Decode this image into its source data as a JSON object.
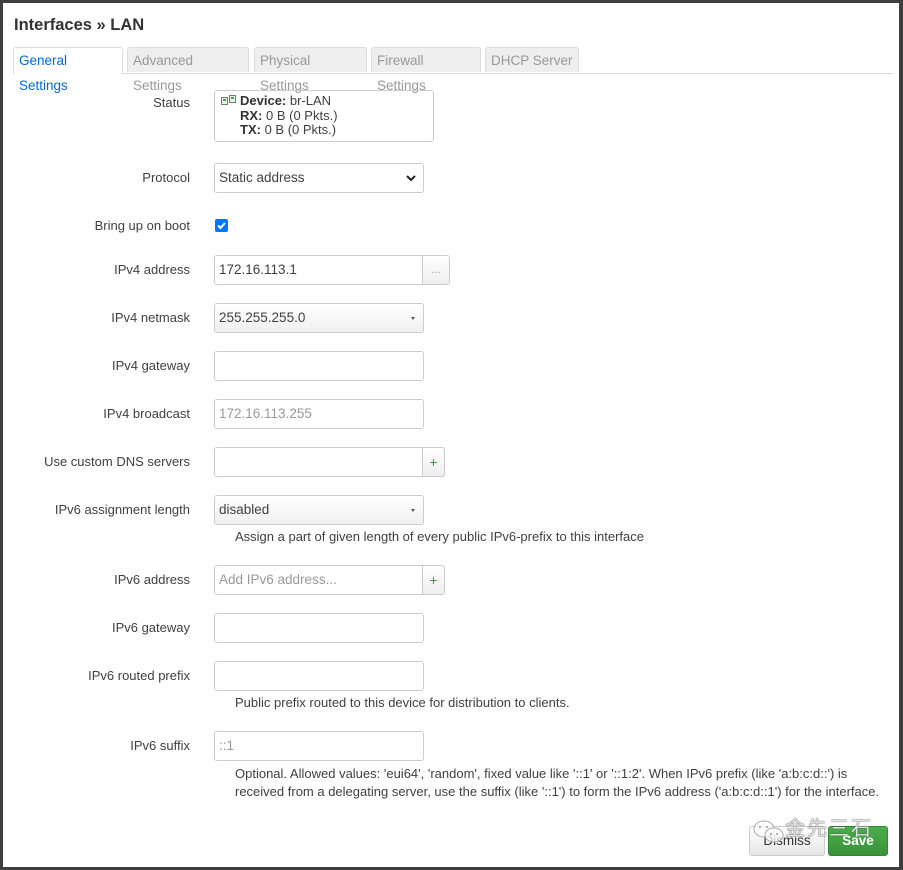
{
  "title": "Interfaces » LAN",
  "tabs": [
    {
      "label": "General Settings",
      "active": true
    },
    {
      "label": "Advanced Settings",
      "active": false
    },
    {
      "label": "Physical Settings",
      "active": false
    },
    {
      "label": "Firewall Settings",
      "active": false
    },
    {
      "label": "DHCP Server",
      "active": false
    }
  ],
  "form": {
    "status": {
      "label": "Status",
      "device_key": "Device:",
      "device_value": "br-LAN",
      "rx_key": "RX:",
      "rx_value": "0 B (0 Pkts.)",
      "tx_key": "TX:",
      "tx_value": "0 B (0 Pkts.)",
      "icon": "network-device-icon"
    },
    "protocol": {
      "label": "Protocol",
      "value": "Static address"
    },
    "bring_up_on_boot": {
      "label": "Bring up on boot",
      "checked": true
    },
    "ipv4_address": {
      "label": "IPv4 address",
      "value": "172.16.113.1",
      "addon": "..."
    },
    "ipv4_netmask": {
      "label": "IPv4 netmask",
      "value": "255.255.255.0"
    },
    "ipv4_gateway": {
      "label": "IPv4 gateway",
      "value": ""
    },
    "ipv4_broadcast": {
      "label": "IPv4 broadcast",
      "placeholder": "172.16.113.255"
    },
    "custom_dns": {
      "label": "Use custom DNS servers",
      "value": "",
      "addon": "+"
    },
    "ipv6_assignment_length": {
      "label": "IPv6 assignment length",
      "value": "disabled",
      "help": "Assign a part of given length of every public IPv6-prefix to this interface"
    },
    "ipv6_address": {
      "label": "IPv6 address",
      "placeholder": "Add IPv6 address...",
      "addon": "+"
    },
    "ipv6_gateway": {
      "label": "IPv6 gateway",
      "value": ""
    },
    "ipv6_routed_prefix": {
      "label": "IPv6 routed prefix",
      "value": "",
      "help": "Public prefix routed to this device for distribution to clients."
    },
    "ipv6_suffix": {
      "label": "IPv6 suffix",
      "placeholder": "::1",
      "help_line1": "Optional. Allowed values: 'eui64', 'random', fixed value like '::1' or '::1:2'. When IPv6 prefix (like 'a:b:c:d::') is",
      "help_line2": "received from a delegating server, use the suffix (like '::1') to form the IPv6 address ('a:b:c:d::1') for the interface."
    }
  },
  "footer": {
    "dismiss_label": "Dismiss",
    "save_label": "Save"
  },
  "watermark": "金先三石",
  "colors": {
    "accent": "#0069d6",
    "save": "#449d44",
    "checkbox": "#0075ff",
    "add": "#3a9a3a"
  }
}
